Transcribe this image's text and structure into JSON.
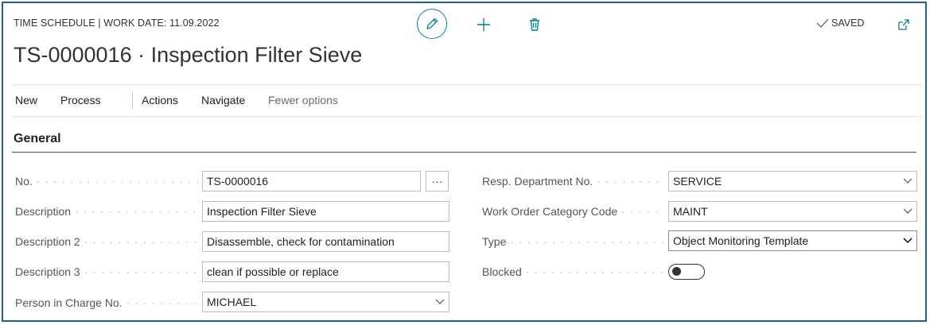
{
  "header": {
    "caption": "TIME SCHEDULE | WORK DATE: 11.09.2022",
    "title": "TS-0000016 · Inspection Filter Sieve",
    "status": "SAVED"
  },
  "menu": {
    "new": "New",
    "process": "Process",
    "actions": "Actions",
    "navigate": "Navigate",
    "fewer_options": "Fewer options"
  },
  "section": {
    "title": "General"
  },
  "fields": {
    "no": {
      "label": "No.",
      "value": "TS-0000016",
      "lookup": "···"
    },
    "description": {
      "label": "Description",
      "value": "Inspection Filter Sieve"
    },
    "description2": {
      "label": "Description 2",
      "value": "Disassemble, check for contamination"
    },
    "description3": {
      "label": "Description 3",
      "value": "clean if possible or replace"
    },
    "person_in_charge": {
      "label": "Person in Charge No.",
      "value": "MICHAEL"
    },
    "resp_department": {
      "label": "Resp. Department No.",
      "value": "SERVICE"
    },
    "work_order_category": {
      "label": "Work Order Category Code",
      "value": "MAINT"
    },
    "type": {
      "label": "Type",
      "value": "Object Monitoring Template"
    },
    "blocked": {
      "label": "Blocked",
      "value": false
    }
  },
  "colors": {
    "accent": "#0f7f8f",
    "frame": "#1f5f8b"
  },
  "icons": [
    "pencil-icon",
    "plus-icon",
    "trash-icon",
    "checkmark-icon",
    "open-in-new-window-icon",
    "chevron-down-icon"
  ]
}
